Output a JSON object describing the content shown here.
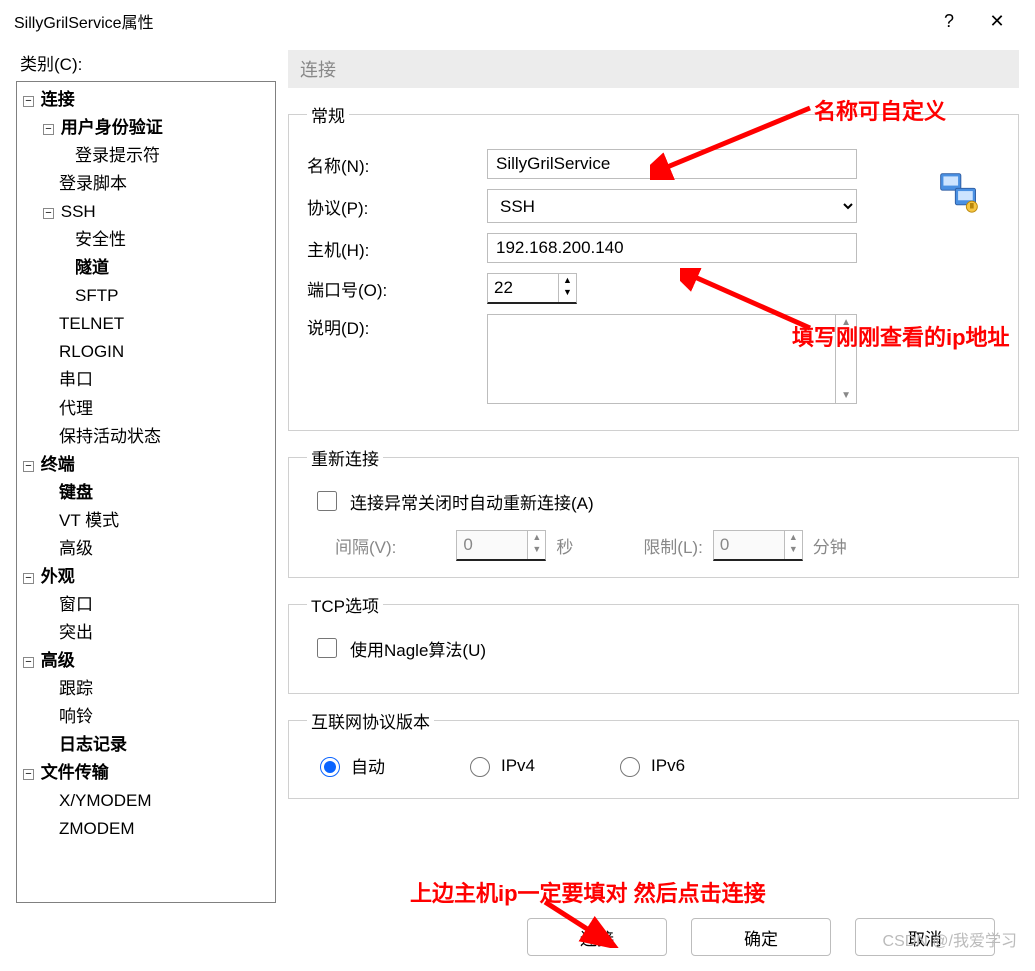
{
  "title": "SillyGrilService属性",
  "category_label": "类别(C):",
  "tree": {
    "n0": "连接",
    "n1": "用户身份验证",
    "n2": "登录提示符",
    "n3": "登录脚本",
    "n4": "SSH",
    "n5": "安全性",
    "n6": "隧道",
    "n7": "SFTP",
    "n8": "TELNET",
    "n9": "RLOGIN",
    "n10": "串口",
    "n11": "代理",
    "n12": "保持活动状态",
    "n13": "终端",
    "n14": "键盘",
    "n15": "VT 模式",
    "n16": "高级",
    "n17": "外观",
    "n18": "窗口",
    "n19": "突出",
    "n20": "高级",
    "n21": "跟踪",
    "n22": "响铃",
    "n23": "日志记录",
    "n24": "文件传输",
    "n25": "X/YMODEM",
    "n26": "ZMODEM"
  },
  "panel": {
    "header": "连接",
    "general": {
      "legend": "常规",
      "name_label": "名称(N):",
      "name_value": "SillyGrilService",
      "protocol_label": "协议(P):",
      "protocol_value": "SSH",
      "host_label": "主机(H):",
      "host_value": "192.168.200.140",
      "port_label": "端口号(O):",
      "port_value": "22",
      "desc_label": "说明(D):",
      "desc_value": ""
    },
    "reconnect": {
      "legend": "重新连接",
      "cb_label": "连接异常关闭时自动重新连接(A)",
      "interval_label": "间隔(V):",
      "interval_value": "0",
      "interval_unit": "秒",
      "limit_label": "限制(L):",
      "limit_value": "0",
      "limit_unit": "分钟"
    },
    "tcp": {
      "legend": "TCP选项",
      "nagle_label": "使用Nagle算法(U)"
    },
    "ipver": {
      "legend": "互联网协议版本",
      "auto": "自动",
      "v4": "IPv4",
      "v6": "IPv6"
    }
  },
  "buttons": {
    "connect": "连接",
    "ok": "确定",
    "cancel": "取消"
  },
  "annotations": {
    "a1": "名称可自定义",
    "a2": "填写刚刚查看的ip地址",
    "a3": "上边主机ip一定要填对  然后点击连接"
  },
  "watermark": "CSDN @/我爱学习"
}
